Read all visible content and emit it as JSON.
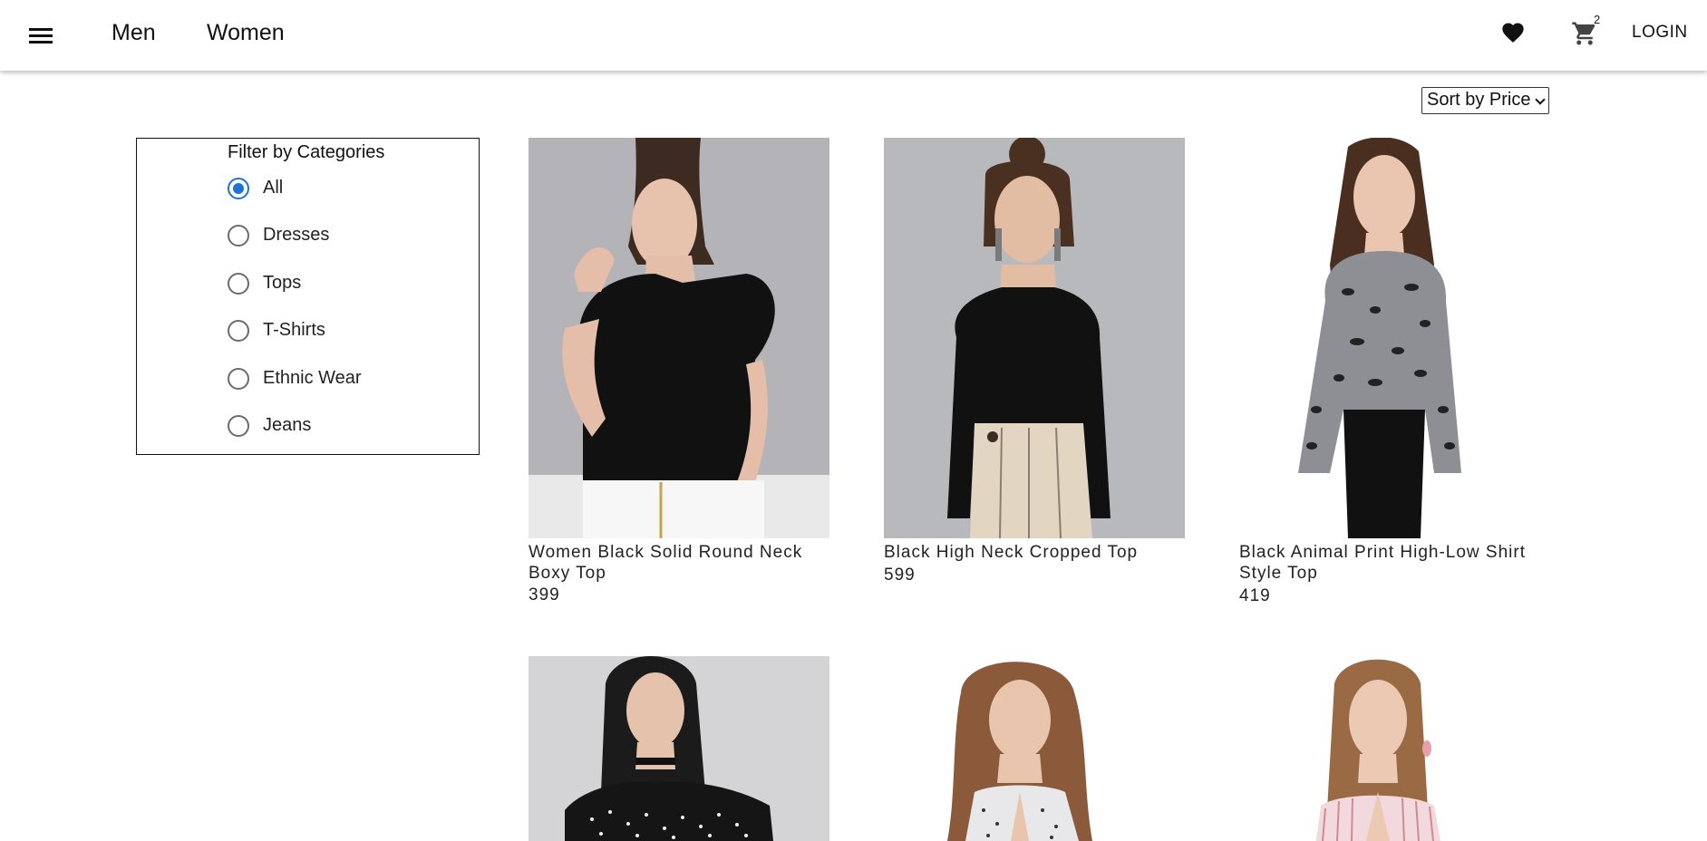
{
  "header": {
    "nav": {
      "men": "Men",
      "women": "Women"
    },
    "cart_count": "2",
    "login_label": "LOGIN"
  },
  "sort": {
    "selected": "Sort by Price"
  },
  "filter": {
    "title": "Filter by Categories",
    "options": [
      "All",
      "Dresses",
      "Tops",
      "T-Shirts",
      "Ethnic Wear",
      "Jeans"
    ],
    "selected": "All",
    "accent_color": "#1a73d9"
  },
  "products": [
    {
      "title": "Women Black Solid Round Neck Boxy Top",
      "price": "399"
    },
    {
      "title": "Black High Neck Cropped Top",
      "price": "599"
    },
    {
      "title": "Black Animal Print High-Low Shirt Style Top",
      "price": "419"
    },
    {
      "title": "",
      "price": ""
    },
    {
      "title": "",
      "price": ""
    },
    {
      "title": "",
      "price": ""
    }
  ]
}
